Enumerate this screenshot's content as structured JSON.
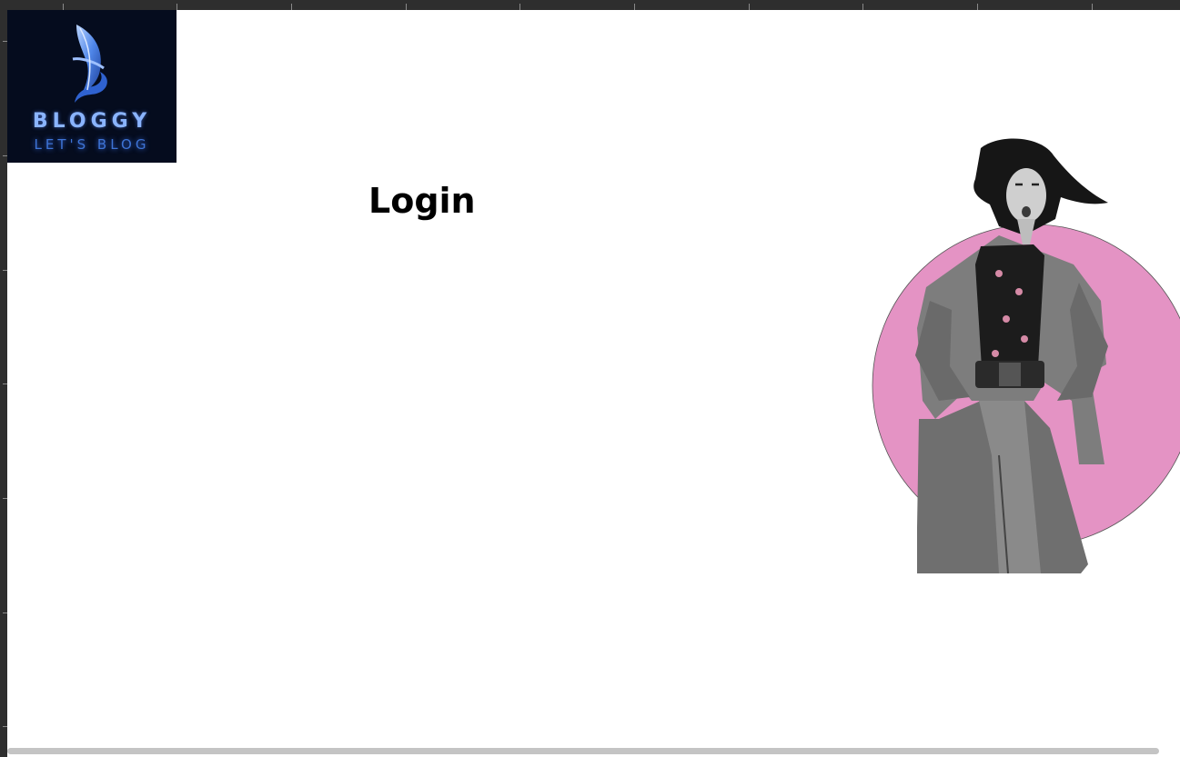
{
  "logo": {
    "brand": "BLOGGY",
    "tagline": "LET'S BLOG",
    "icon": "feather-icon"
  },
  "main": {
    "title": "Login"
  },
  "hero": {
    "icon": "person-illustration",
    "circle_color": "#e493c4"
  },
  "colors": {
    "logo_background": "#050c1e",
    "brand_text": "#8ab4ff",
    "tagline_text": "#3e74d6",
    "ruler": "#2e2e2e"
  }
}
